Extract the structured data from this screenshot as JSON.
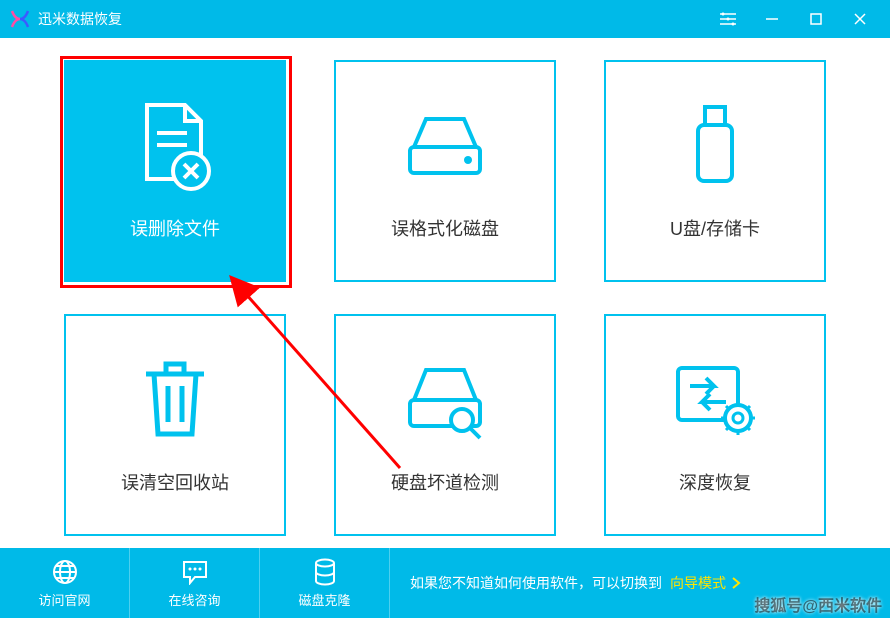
{
  "app": {
    "title": "迅米数据恢复"
  },
  "cards": [
    {
      "label": "误删除文件"
    },
    {
      "label": "误格式化磁盘"
    },
    {
      "label": "U盘/存储卡"
    },
    {
      "label": "误清空回收站"
    },
    {
      "label": "硬盘坏道检测"
    },
    {
      "label": "深度恢复"
    }
  ],
  "footer": {
    "website": "访问官网",
    "consult": "在线咨询",
    "clone": "磁盘克隆",
    "hint": "如果您不知道如何使用软件，可以切换到",
    "wizard": "向导模式"
  },
  "watermark": "搜狐号@西米软件"
}
